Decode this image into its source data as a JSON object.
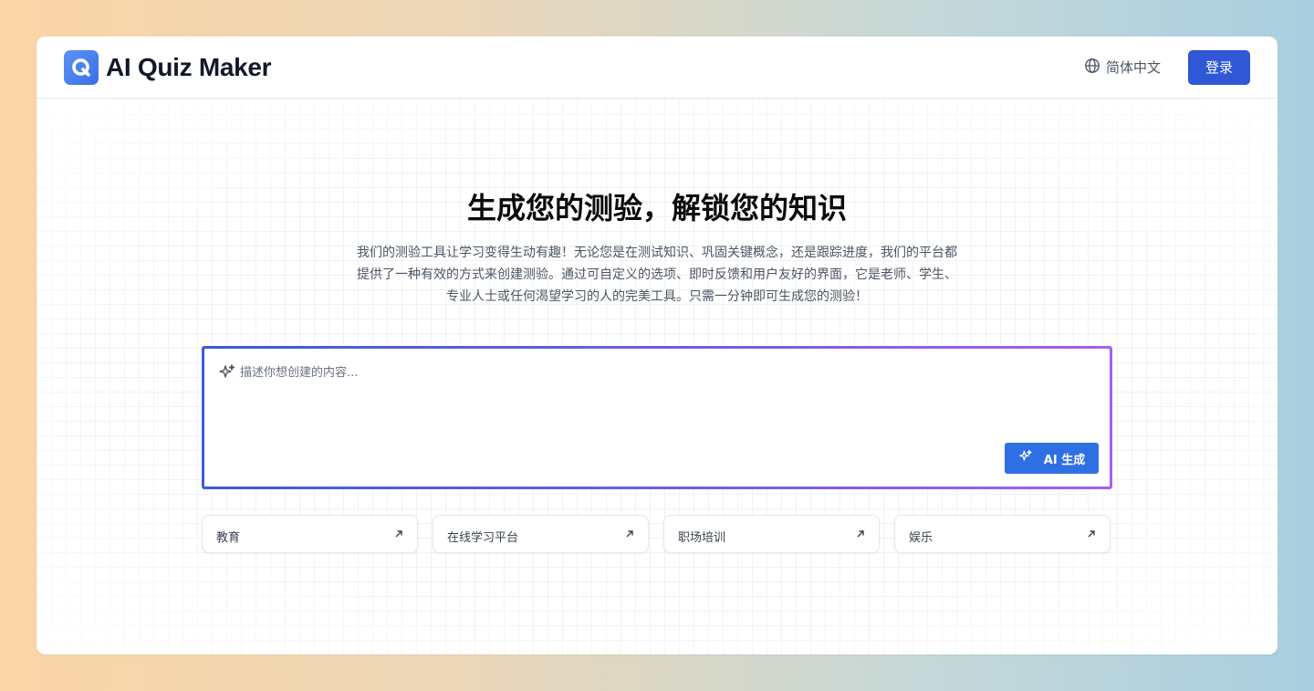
{
  "header": {
    "brand": "AI Quiz Maker",
    "language": "简体中文",
    "login_label": "登录"
  },
  "hero": {
    "title": "生成您的测验，解锁您的知识",
    "description": "我们的测验工具让学习变得生动有趣！无论您是在测试知识、巩固关键概念，还是跟踪进度，我们的平台都提供了一种有效的方式来创建测验。通过可自定义的选项、即时反馈和用户友好的界面，它是老师、学生、专业人士或任何渴望学习的人的完美工具。只需一分钟即可生成您的测验！"
  },
  "prompt": {
    "placeholder": "描述你想创建的内容...",
    "value": "",
    "generate_label": "AI 生成"
  },
  "categories": [
    {
      "label": "教育"
    },
    {
      "label": "在线学习平台"
    },
    {
      "label": "职场培训"
    },
    {
      "label": "娱乐"
    }
  ],
  "icons": {
    "logo": "quiz-logo-icon",
    "language": "globe-icon",
    "prompt": "sparkles-icon",
    "generate": "sparkles-icon",
    "chip": "arrow-up-right-icon"
  },
  "colors": {
    "primary": "#2f57d6",
    "generate": "#2f6fe4",
    "gradient_start": "#3c5ad8",
    "gradient_end": "#a75ef0"
  }
}
